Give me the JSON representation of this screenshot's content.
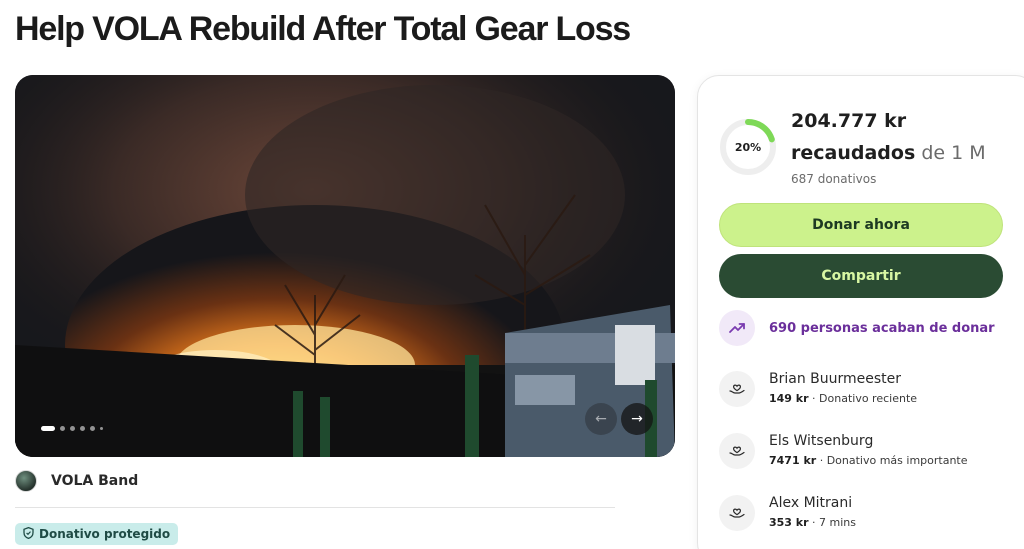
{
  "campaign": {
    "title": "Help VOLA Rebuild After Total Gear Loss"
  },
  "gallery": {
    "image_description": "burning-building-at-night",
    "slide_count": 6,
    "active_slide": 1,
    "prev_icon": "arrow-left-icon",
    "next_icon": "arrow-right-icon"
  },
  "organizer": {
    "name": "VOLA Band"
  },
  "badge": {
    "label": "Donativo protegido",
    "icon": "shield-icon"
  },
  "progress": {
    "percent_label": "20%",
    "percent_value": 0.2,
    "amount_raised": "204.777 kr",
    "raised_word": "recaudados",
    "goal_text": "de 1 M",
    "donations_count": "687 donativos",
    "accent_color": "#7ed957",
    "track_color": "#eeeeee"
  },
  "actions": {
    "donate_label": "Donar ahora",
    "share_label": "Compartir",
    "donate_color": "#ccf28c",
    "share_color": "#2a4b33"
  },
  "activity": {
    "recent_text": "690 personas acaban de donar",
    "icon": "trending-up-icon",
    "color": "#6b2f9b"
  },
  "donors": [
    {
      "name": "Brian Buurmeester",
      "amount": "149 kr",
      "note": "Donativo reciente"
    },
    {
      "name": "Els Witsenburg",
      "amount": "7471 kr",
      "note": "Donativo más importante"
    },
    {
      "name": "Alex Mitrani",
      "amount": "353 kr",
      "note": "7 mins"
    }
  ]
}
